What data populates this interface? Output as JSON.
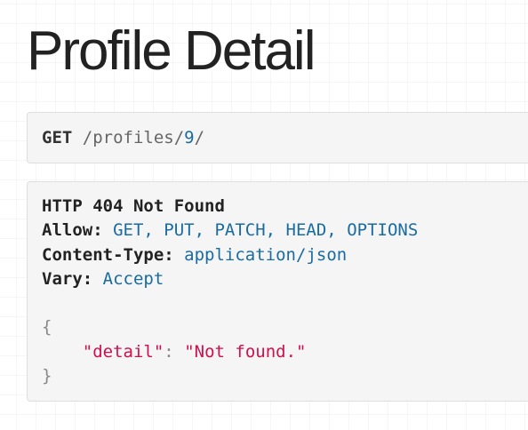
{
  "page": {
    "title": "Profile Detail"
  },
  "request": {
    "method": "GET",
    "path_prefix": "/profiles/",
    "path_id": "9",
    "path_suffix": "/"
  },
  "response": {
    "status_line": "HTTP 404 Not Found",
    "headers": [
      {
        "name": "Allow:",
        "value": "GET, PUT, PATCH, HEAD, OPTIONS"
      },
      {
        "name": "Content-Type:",
        "value": "application/json"
      },
      {
        "name": "Vary:",
        "value": "Accept"
      }
    ],
    "body": {
      "open_brace": "{",
      "key": "\"detail\"",
      "colon": ":",
      "value": "\"Not found.\"",
      "close_brace": "}"
    }
  },
  "colors": {
    "accent_blue": "#1a6ba0",
    "json_string": "#d0104c",
    "panel_bg": "#f5f5f5"
  }
}
